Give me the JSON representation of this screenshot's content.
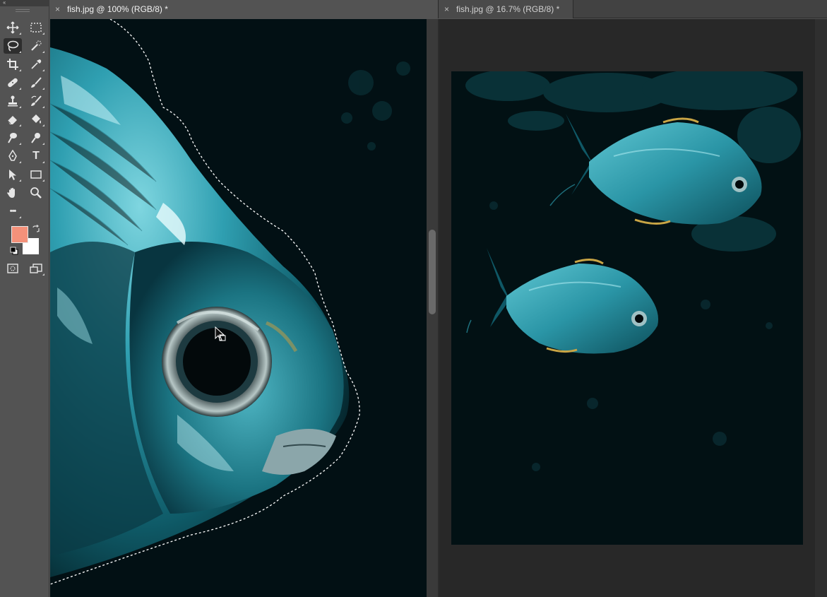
{
  "toolbar": {
    "collapse_label": "‹‹",
    "tools": [
      {
        "name": "move",
        "icon": "move-icon"
      },
      {
        "name": "rectangular-marquee",
        "icon": "marquee-icon"
      },
      {
        "name": "lasso",
        "icon": "lasso-icon",
        "active": true
      },
      {
        "name": "quick-selection",
        "icon": "quick-selection-icon"
      },
      {
        "name": "crop",
        "icon": "crop-icon"
      },
      {
        "name": "eyedropper",
        "icon": "eyedropper-icon"
      },
      {
        "name": "healing-brush",
        "icon": "bandage-icon"
      },
      {
        "name": "brush",
        "icon": "brush-icon"
      },
      {
        "name": "clone-stamp",
        "icon": "stamp-icon"
      },
      {
        "name": "history-brush",
        "icon": "history-brush-icon"
      },
      {
        "name": "eraser",
        "icon": "eraser-icon"
      },
      {
        "name": "paint-bucket",
        "icon": "bucket-icon"
      },
      {
        "name": "smudge",
        "icon": "smudge-icon"
      },
      {
        "name": "dodge",
        "icon": "dodge-icon"
      },
      {
        "name": "pen",
        "icon": "pen-icon"
      },
      {
        "name": "type",
        "icon": "type-icon",
        "label": "T"
      },
      {
        "name": "path-selection",
        "icon": "arrow-icon"
      },
      {
        "name": "rectangle",
        "icon": "rectangle-icon"
      },
      {
        "name": "hand",
        "icon": "hand-icon"
      },
      {
        "name": "zoom",
        "icon": "zoom-icon"
      },
      {
        "name": "edit-toolbar",
        "icon": "more-icon",
        "label": "•••"
      },
      {
        "name": "quick-mask",
        "icon": "quick-mask-icon"
      },
      {
        "name": "screen-mode",
        "icon": "screen-mode-icon"
      }
    ],
    "foreground_color": "#f4917a",
    "background_color": "#ffffff"
  },
  "tabs": [
    {
      "label": "fish.jpg @ 100% (RGB/8) *",
      "close": "×",
      "active": true
    },
    {
      "label": "fish.jpg @ 16.7% (RGB/8) *",
      "close": "×",
      "active": false
    }
  ],
  "colors": {
    "canvas_bg": "#021014",
    "fish_teal": "#2aa3b5",
    "fish_highlight": "#bdf2f6",
    "ui_panel": "#535353",
    "pasteboard": "#282828"
  }
}
